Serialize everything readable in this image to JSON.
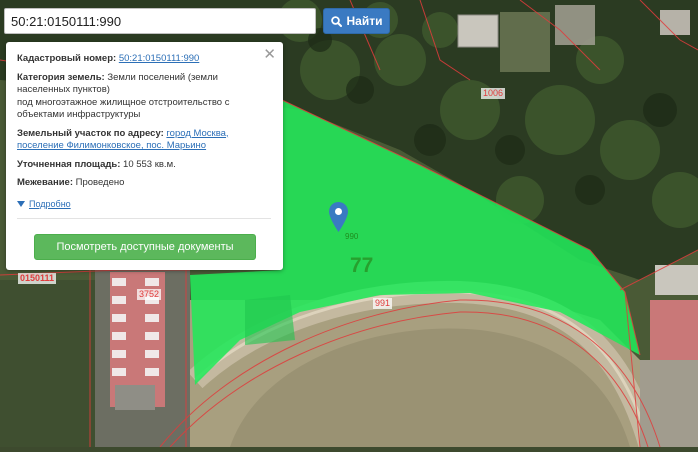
{
  "search": {
    "value": "50:21:0150111:990",
    "button_label": "Найти"
  },
  "popup": {
    "cadastral_label": "Кадастровый номер:",
    "cadastral_value": "50:21:0150111:990",
    "category_label": "Категория земель:",
    "category_value_1": "Земли поселений (земли",
    "category_value_2": "населенных пунктов)",
    "category_value_3": "под многоэтажное жилищное отстроительство с",
    "category_value_4": "объектами инфраструктуры",
    "address_label": "Земельный участок по адресу:",
    "address_value_1": "город Москва,",
    "address_value_2": "поселение Филимонковское, пос. Марьино",
    "area_label": "Уточненная площадь:",
    "area_value": "10 553 кв.м.",
    "survey_label": "Межевание:",
    "survey_value": "Проведено",
    "more_label": "Подробно",
    "docs_button": "Посмотреть доступные документы"
  },
  "map": {
    "labels": {
      "parcel_1006": "1006",
      "parcel_991": "991",
      "parcel_3752": "3752",
      "quarter": "0150111",
      "block_77": "77",
      "pin_990": "990"
    }
  },
  "colors": {
    "parcel_fill": "#22e85a",
    "boundary": "#e03c3c",
    "accent_blue": "#3a7ac2",
    "docs_green": "#5cb85c"
  },
  "icons": {
    "search": "search-icon",
    "close": "close-icon",
    "caret": "caret-down-icon",
    "pin": "map-pin-icon"
  }
}
